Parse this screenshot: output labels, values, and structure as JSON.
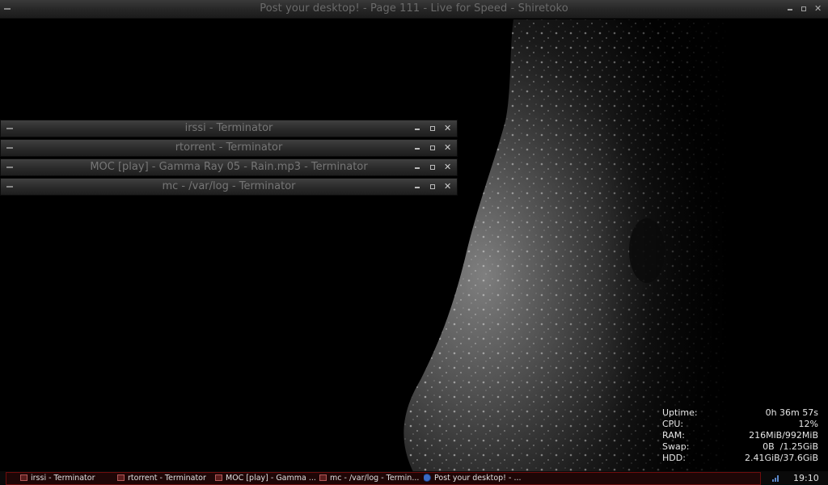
{
  "browser_window": {
    "title": "Post your desktop! - Page 111 - Live for Speed - Shiretoko"
  },
  "terminals": [
    {
      "title": "irssi - Terminator"
    },
    {
      "title": "rtorrent - Terminator"
    },
    {
      "title": "MOC [play] - Gamma Ray 05 - Rain.mp3 - Terminator"
    },
    {
      "title": "mc - /var/log - Terminator"
    }
  ],
  "conky": {
    "uptime_label": "Uptime:",
    "uptime_value": "0h 36m 57s",
    "cpu_label": "CPU:",
    "cpu_value": "12%",
    "ram_label": "RAM:",
    "ram_value": "216MiB/992MiB",
    "swap_label": "Swap:",
    "swap_value": "0B  /1.25GiB",
    "hdd_label": "HDD:",
    "hdd_value": "2.41GiB/37.6GiB"
  },
  "taskbar": {
    "tasks": [
      {
        "label": "irssi - Terminator"
      },
      {
        "label": "rtorrent - Terminator"
      },
      {
        "label": "MOC [play] - Gamma ..."
      },
      {
        "label": "mc - /var/log - Termin..."
      },
      {
        "label": "Post your desktop! - ..."
      }
    ],
    "clock": "19:10"
  },
  "icons": {
    "window_menu": "dash-icon",
    "minimize": "minimize-icon",
    "maximize": "maximize-icon",
    "close": "close-icon",
    "terminal": "terminal-icon",
    "browser": "browser-icon",
    "network": "network-signal-icon"
  },
  "colors": {
    "taskbar_border": "#6e0d0d",
    "taskbar_bg": "#1e0606"
  }
}
